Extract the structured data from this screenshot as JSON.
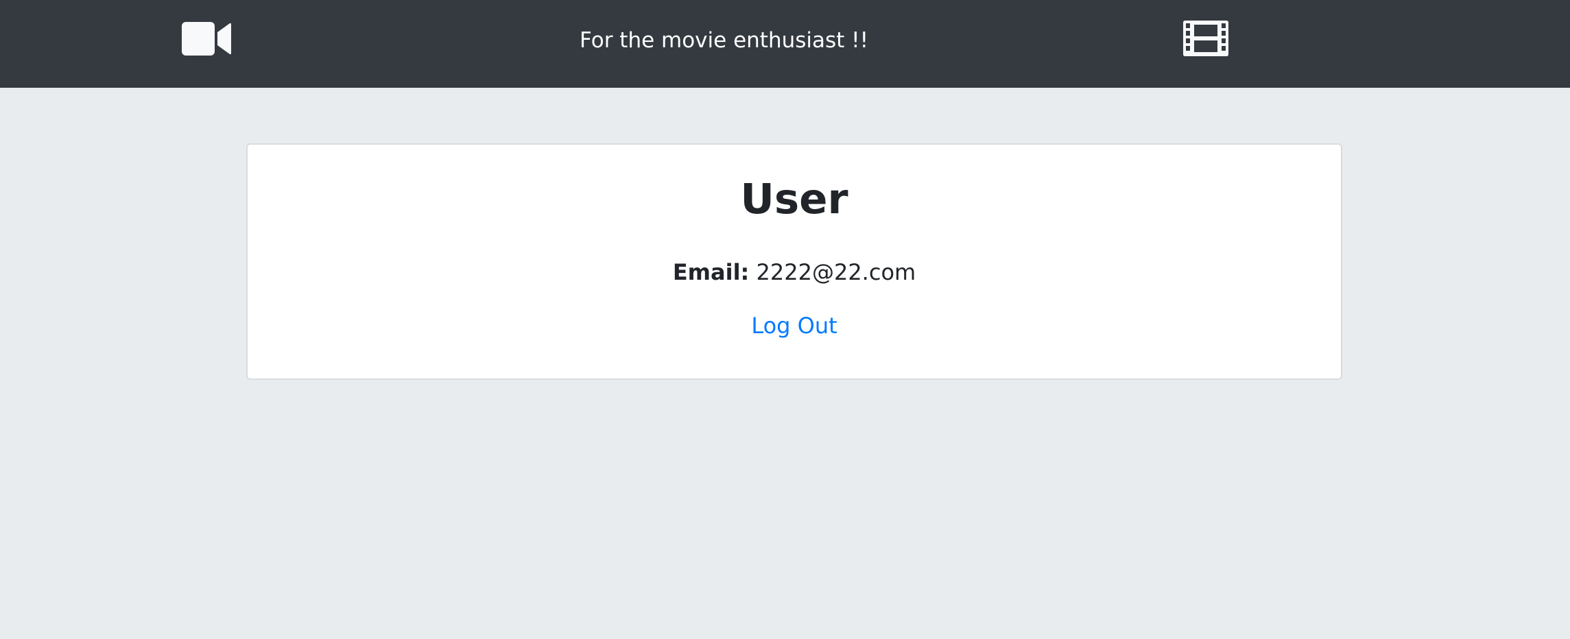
{
  "navbar": {
    "logo_icon": "video-camera-icon",
    "tagline": "For the movie enthusiast !!",
    "film_icon": "film-icon",
    "background": "#343a40",
    "icon_color": "#f8f9fa"
  },
  "user_card": {
    "title": "User",
    "email_label": "Email:",
    "email_value": "2222@22.com",
    "logout_label": "Log Out",
    "link_color": "#007bff"
  },
  "page": {
    "background": "#e9ecef"
  }
}
